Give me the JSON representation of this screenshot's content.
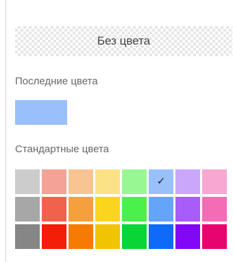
{
  "no_color": {
    "label": "Без цвета"
  },
  "recent": {
    "label": "Последние цвета",
    "colors": [
      "#99c0fb"
    ]
  },
  "standard": {
    "label": "Стандартные цвета",
    "rows": [
      [
        "#cccccc",
        "#f4a296",
        "#f8c592",
        "#fbe286",
        "#98f792",
        "#99c0fb",
        "#caa7fb",
        "#f7a7d2"
      ],
      [
        "#a7a7a7",
        "#f1624d",
        "#f59f3d",
        "#fbd41d",
        "#4cf04c",
        "#65a4fb",
        "#a85cf9",
        "#f46bb6"
      ],
      [
        "#868686",
        "#f41d08",
        "#f67b02",
        "#f2c302",
        "#0ad536",
        "#0e6af9",
        "#8207f6",
        "#e6056f"
      ]
    ],
    "selected": {
      "row": 0,
      "col": 5,
      "icon": "checkmark-icon",
      "glyph": "✓"
    }
  }
}
